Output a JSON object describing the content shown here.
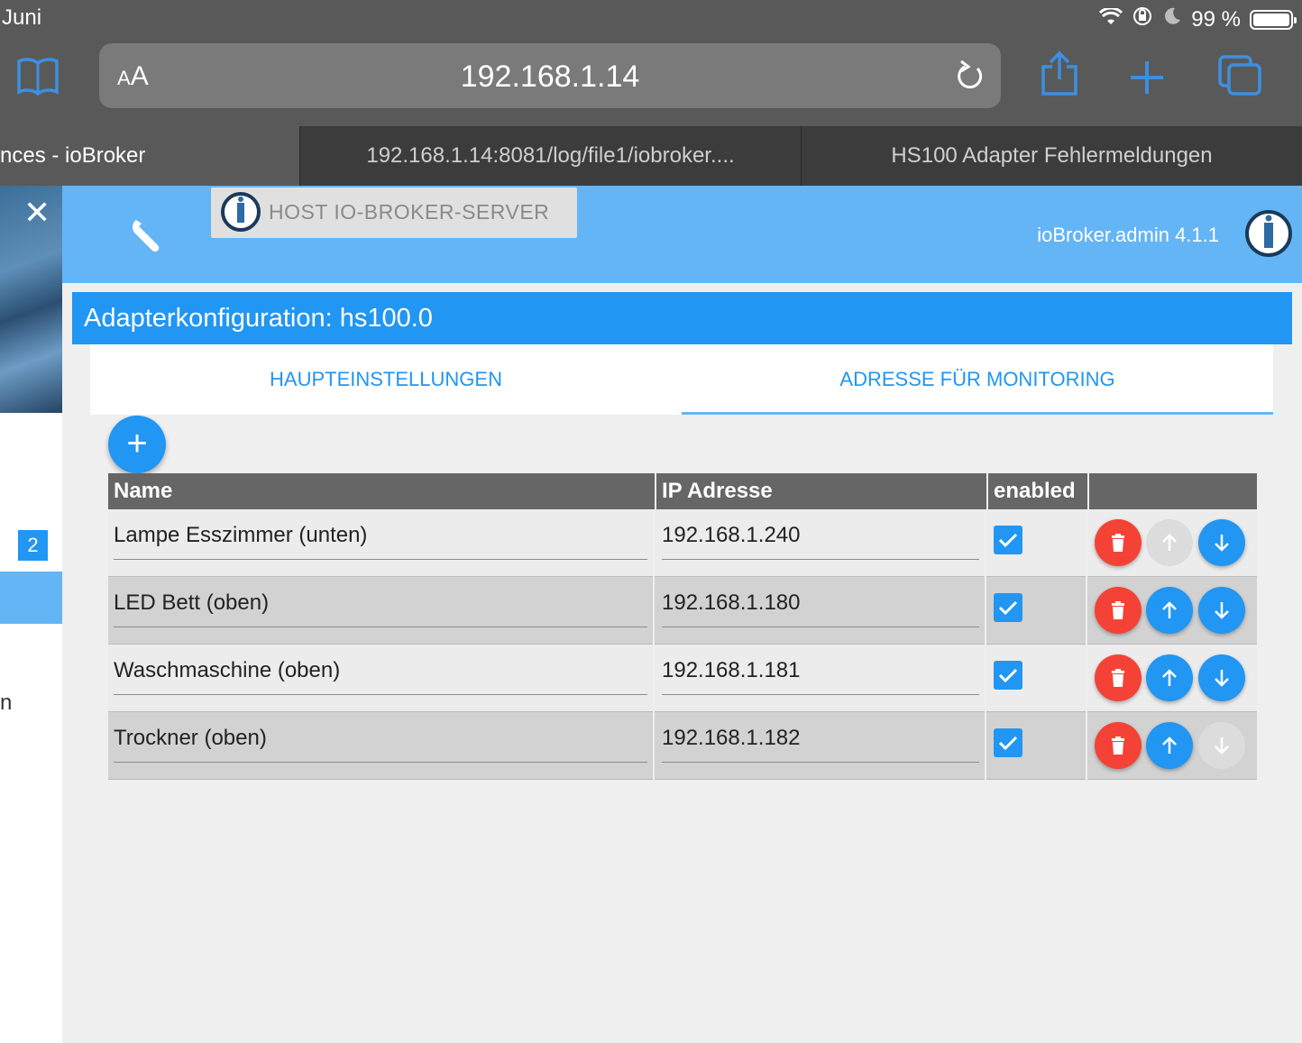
{
  "status_bar": {
    "time": "Juni",
    "battery": "99 %"
  },
  "browser": {
    "aa_small": "A",
    "aa_large": "A",
    "url": "192.168.1.14",
    "tabs": [
      {
        "label": "nces - ioBroker",
        "active": true
      },
      {
        "label": "192.168.1.14:8081/log/file1/iobroker....",
        "active": false
      },
      {
        "label": "HS100 Adapter Fehlermeldungen",
        "active": false
      }
    ]
  },
  "sidebar": {
    "badge": "2",
    "partial_text": "n"
  },
  "header": {
    "host_label": "HOST IO-BROKER-SERVER",
    "version": "ioBroker.admin 4.1.1"
  },
  "config": {
    "title": "Adapterkonfiguration: hs100.0",
    "tabs": [
      "HAUPTEINSTELLUNGEN",
      "ADRESSE FÜR MONITORING"
    ],
    "active_tab": 1
  },
  "table": {
    "columns": [
      "Name",
      "IP Adresse",
      "enabled",
      ""
    ],
    "rows": [
      {
        "name": "Lampe Esszimmer (unten)",
        "ip": "192.168.1.240",
        "enabled": true,
        "up_enabled": false,
        "down_enabled": true
      },
      {
        "name": "LED Bett (oben)",
        "ip": "192.168.1.180",
        "enabled": true,
        "up_enabled": true,
        "down_enabled": true
      },
      {
        "name": "Waschmaschine (oben)",
        "ip": "192.168.1.181",
        "enabled": true,
        "up_enabled": true,
        "down_enabled": true
      },
      {
        "name": "Trockner (oben)",
        "ip": "192.168.1.182",
        "enabled": true,
        "up_enabled": true,
        "down_enabled": false
      }
    ]
  },
  "colors": {
    "primary": "#2196f3",
    "header": "#64b5f6",
    "delete": "#f44336",
    "disabled": "#dcdcdc"
  }
}
